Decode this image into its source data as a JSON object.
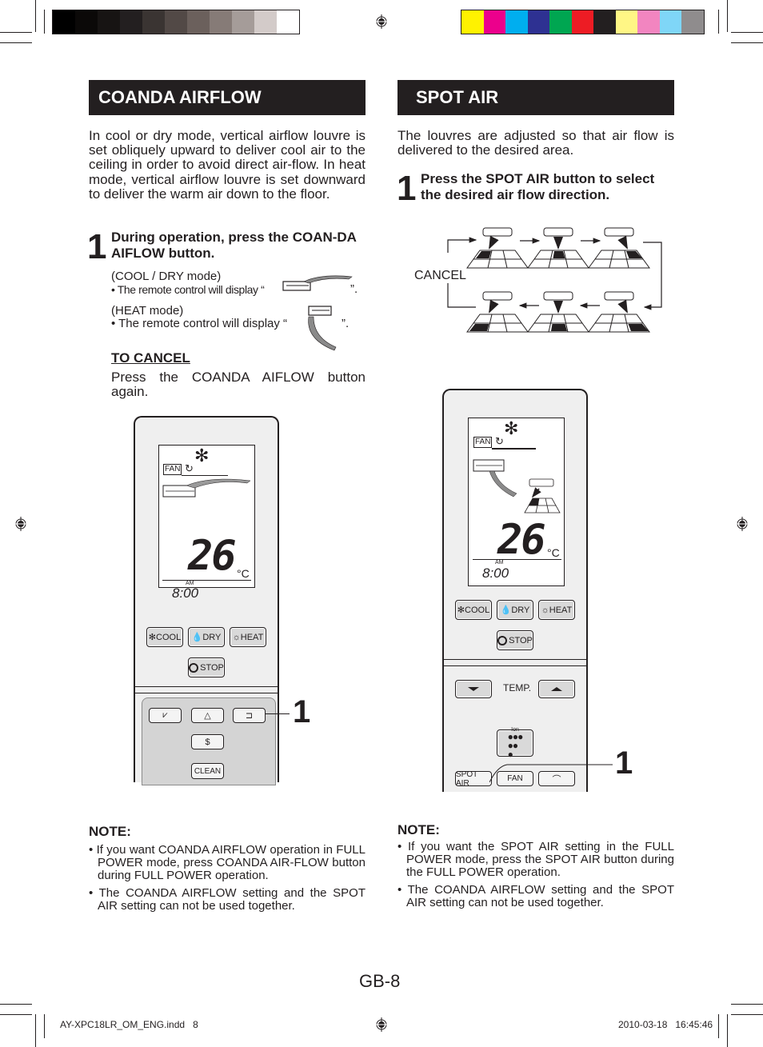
{
  "print_marks": {
    "gray_swatches": [
      "#000000",
      "#0b0908",
      "#171413",
      "#231f20",
      "#3a3432",
      "#524946",
      "#6b605c",
      "#867b77",
      "#a59c99",
      "#d3cbc9",
      "#ffffff"
    ],
    "color_swatches": [
      "#fff200",
      "#ec008c",
      "#00aeef",
      "#2e3192",
      "#00a651",
      "#ed1c24",
      "#231f20",
      "#fff685",
      "#f285c0",
      "#7fd6f7",
      "#8f8c8d"
    ]
  },
  "coanda": {
    "title": "COANDA AIRFLOW",
    "intro": "In cool or dry mode, vertical airflow louvre is set obliquely upward to deliver cool air to the ceiling in order to avoid direct air-flow. In heat mode, vertical airflow louvre is set downward to deliver the warm air down to the floor.",
    "step_number": "1",
    "step_text": "During operation, press the COAN-DA AIFLOW button.",
    "cool_dry_mode_label": "(COOL / DRY mode)",
    "cool_dry_display_pre": "• The remote control will display “",
    "cool_dry_display_post": "”.",
    "heat_mode_label": "(HEAT mode)",
    "heat_display_pre": "• The remote control will display “",
    "heat_display_post": "”.",
    "cancel_heading": "TO CANCEL",
    "cancel_text": "Press the COANDA AIFLOW button again.",
    "note_heading": "NOTE:",
    "notes": [
      "• If you want COANDA AIRFLOW operation in FULL POWER mode, press COANDA AIR-FLOW button during FULL POWER operation.",
      "• The COANDA AIRFLOW setting and the SPOT AIR setting can not be used together."
    ]
  },
  "spot": {
    "title": "SPOT AIR",
    "intro": "The louvres are adjusted so that air flow is delivered to the desired area.",
    "step_number": "1",
    "step_text": "Press the SPOT AIR button to select the desired air flow direction.",
    "cycle_cancel_label": "CANCEL",
    "cycle_positions": [
      "front-left",
      "front-center",
      "front-right",
      "rear-right",
      "rear-center",
      "rear-left"
    ],
    "note_heading": "NOTE:",
    "notes": [
      "• If you want the SPOT AIR setting in the FULL POWER mode, press the SPOT AIR button during the FULL POWER operation.",
      "• The COANDA AIRFLOW setting and the SPOT AIR setting can not be used together."
    ]
  },
  "remote_left": {
    "lcd": {
      "fan_label": "FAN",
      "temperature": "26",
      "unit": "°C",
      "ampm": "AM",
      "time": "8:00"
    },
    "buttons": {
      "cool": "COOL",
      "dry": "DRY",
      "heat": "HEAT",
      "stop": "STOP",
      "clean": "CLEAN"
    },
    "callout": "1"
  },
  "remote_right": {
    "lcd": {
      "fan_label": "FAN",
      "temperature": "26",
      "unit": "°C",
      "ampm": "AM",
      "time": "8:00"
    },
    "buttons": {
      "cool": "COOL",
      "dry": "DRY",
      "heat": "HEAT",
      "stop": "STOP",
      "temp_label": "TEMP.",
      "ion": "Ion",
      "spot_air": "SPOT AIR",
      "fan": "FAN"
    },
    "callout": "1"
  },
  "page_number": "GB-8",
  "footer": {
    "file": "AY-XPC18LR_OM_ENG.indd   8",
    "timestamp": "2010-03-18   16:45:46"
  }
}
